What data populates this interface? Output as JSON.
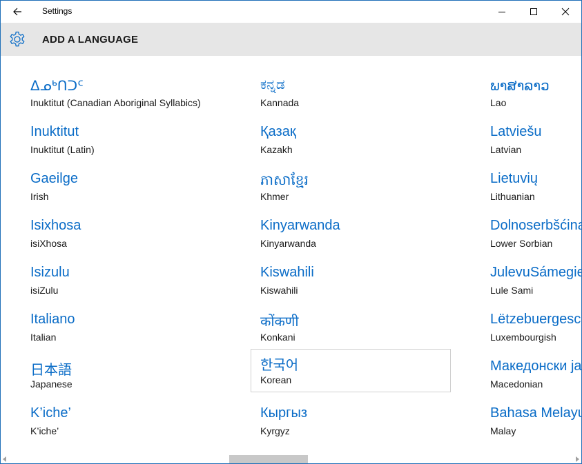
{
  "window": {
    "app_title": "Settings",
    "accent_color": "#0a6cc7"
  },
  "header": {
    "title": "ADD A LANGUAGE",
    "icon": "gear-icon"
  },
  "languages": [
    {
      "native": "ᐃᓄᒃᑎᑐᑦ",
      "english": "Inuktitut (Canadian Aboriginal Syllabics)"
    },
    {
      "native": "Inuktitut",
      "english": "Inuktitut (Latin)"
    },
    {
      "native": "Gaeilge",
      "english": "Irish"
    },
    {
      "native": "Isixhosa",
      "english": "isiXhosa"
    },
    {
      "native": "Isizulu",
      "english": "isiZulu"
    },
    {
      "native": "Italiano",
      "english": "Italian"
    },
    {
      "native": "日本語",
      "english": "Japanese"
    },
    {
      "native": "K’iche’",
      "english": "K’iche’"
    },
    {
      "native": "ಕನ್ನಡ",
      "english": "Kannada"
    },
    {
      "native": "Қазақ",
      "english": "Kazakh"
    },
    {
      "native": "ភាសាខ្មែរ",
      "english": "Khmer"
    },
    {
      "native": "Kinyarwanda",
      "english": "Kinyarwanda"
    },
    {
      "native": "Kiswahili",
      "english": "Kiswahili"
    },
    {
      "native": "कोंकणी",
      "english": "Konkani"
    },
    {
      "native": "한국어",
      "english": "Korean"
    },
    {
      "native": "Кыргыз",
      "english": "Kyrgyz"
    },
    {
      "native": "ພາສາລາວ",
      "english": "Lao"
    },
    {
      "native": "Latviešu",
      "english": "Latvian"
    },
    {
      "native": "Lietuvių",
      "english": "Lithuanian"
    },
    {
      "native": "Dolnoserbšćina",
      "english": "Lower Sorbian"
    },
    {
      "native": "JulevuSámegiella",
      "english": "Lule Sami"
    },
    {
      "native": "Lëtzebuergesch",
      "english": "Luxembourgish"
    },
    {
      "native": "Македонски јазик",
      "english": "Macedonian"
    },
    {
      "native": "Bahasa Melayu",
      "english": "Malay"
    }
  ],
  "selected_language": "Korean"
}
